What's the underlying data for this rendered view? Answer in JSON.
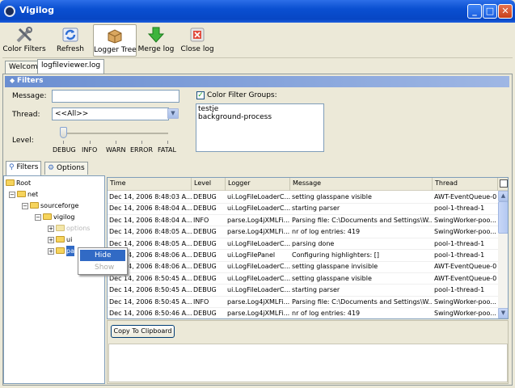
{
  "window": {
    "title": "Vigilog",
    "min": "_",
    "max": "□",
    "close": "✕"
  },
  "toolbar": {
    "color_filters": "Color Filters",
    "refresh": "Refresh",
    "logger_tree": "Logger Tree",
    "merge_log": "Merge log",
    "close_log": "Close log"
  },
  "file_tabs": [
    "Welcome",
    "logfileviewer.log"
  ],
  "filters": {
    "heading": "Filters",
    "message_label": "Message:",
    "message_value": "",
    "thread_label": "Thread:",
    "thread_value": "<<All>>",
    "level_label": "Level:",
    "levels": [
      "DEBUG",
      "INFO",
      "WARN",
      "ERROR",
      "FATAL"
    ],
    "level_value": "DEBUG",
    "color_groups_label": "Color Filter Groups:",
    "color_groups_checked": true,
    "color_groups": [
      "testje",
      "background-process"
    ]
  },
  "lower_tabs": [
    "Filters",
    "Options"
  ],
  "tree": {
    "root": "Root",
    "net": "net",
    "sourceforge": "sourceforge",
    "vigilog": "vigilog",
    "children": [
      "options",
      "ui",
      "parser"
    ]
  },
  "context_menu": {
    "hide": "Hide",
    "show": "Show"
  },
  "grid": {
    "columns": [
      "Time",
      "Level",
      "Logger",
      "Message",
      "Thread"
    ],
    "rows": [
      [
        "Dec 14, 2006 8:48:03 A...",
        "DEBUG",
        "ui.LogFileLoaderC...",
        "setting glasspane visible",
        "AWT-EventQueue-0"
      ],
      [
        "Dec 14, 2006 8:48:04 A...",
        "DEBUG",
        "ui.LogFileLoaderC...",
        "starting parser",
        "pool-1-thread-1"
      ],
      [
        "Dec 14, 2006 8:48:04 A...",
        "INFO",
        "parse.Log4jXMLFi...",
        "Parsing file: C:\\Documents and Settings\\W...",
        "SwingWorker-poo..."
      ],
      [
        "Dec 14, 2006 8:48:05 A...",
        "DEBUG",
        "parse.Log4jXMLFi...",
        "nr of log entries: 419",
        "SwingWorker-poo..."
      ],
      [
        "Dec 14, 2006 8:48:05 A...",
        "DEBUG",
        "ui.LogFileLoaderC...",
        "parsing done",
        "pool-1-thread-1"
      ],
      [
        "Dec 14, 2006 8:48:06 A...",
        "DEBUG",
        "ui.LogFilePanel",
        "Configuring highlighters: []",
        "pool-1-thread-1"
      ],
      [
        "Dec 14, 2006 8:48:06 A...",
        "DEBUG",
        "ui.LogFileLoaderC...",
        "setting glasspane invisible",
        "AWT-EventQueue-0"
      ],
      [
        "Dec 14, 2006 8:50:45 A...",
        "DEBUG",
        "ui.LogFileLoaderC...",
        "setting glasspane visible",
        "AWT-EventQueue-0"
      ],
      [
        "Dec 14, 2006 8:50:45 A...",
        "DEBUG",
        "ui.LogFileLoaderC...",
        "starting parser",
        "pool-1-thread-1"
      ],
      [
        "Dec 14, 2006 8:50:45 A...",
        "INFO",
        "parse.Log4jXMLFi...",
        "Parsing file: C:\\Documents and Settings\\W...",
        "SwingWorker-poo..."
      ],
      [
        "Dec 14, 2006 8:50:46 A...",
        "DEBUG",
        "parse.Log4jXMLFi...",
        "nr of log entries: 419",
        "SwingWorker-poo..."
      ]
    ]
  },
  "bottom": {
    "copy_button": "Copy To Clipboard"
  },
  "colors": {
    "titlebar": "#0a4fd0",
    "selection": "#316ac5",
    "panel": "#ece9d8"
  }
}
